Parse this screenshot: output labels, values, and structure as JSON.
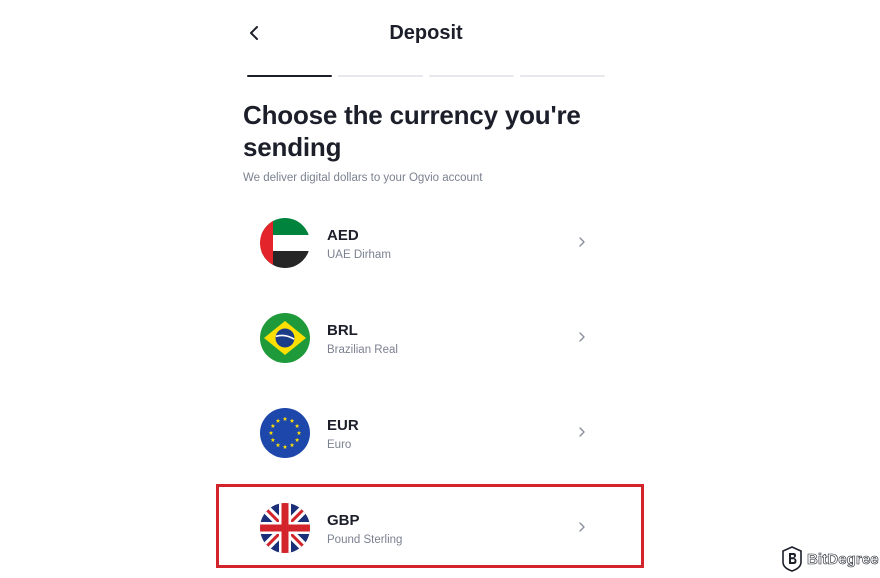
{
  "header": {
    "title": "Deposit",
    "back_icon": "chevron-left-icon"
  },
  "progress": {
    "steps": 4,
    "current_step": 1
  },
  "heading": "Choose the currency you're sending",
  "subtitle": "We deliver digital dollars to your Ogvio account",
  "currencies": [
    {
      "code": "AED",
      "name": "UAE Dirham",
      "flag": "uae-flag-icon"
    },
    {
      "code": "BRL",
      "name": "Brazilian Real",
      "flag": "brazil-flag-icon"
    },
    {
      "code": "EUR",
      "name": "Euro",
      "flag": "eu-flag-icon"
    },
    {
      "code": "GBP",
      "name": "Pound Sterling",
      "flag": "uk-flag-icon"
    }
  ],
  "highlighted_currency": "GBP",
  "highlight_color": "#d3242b",
  "watermark": {
    "text": "BitDegree"
  }
}
